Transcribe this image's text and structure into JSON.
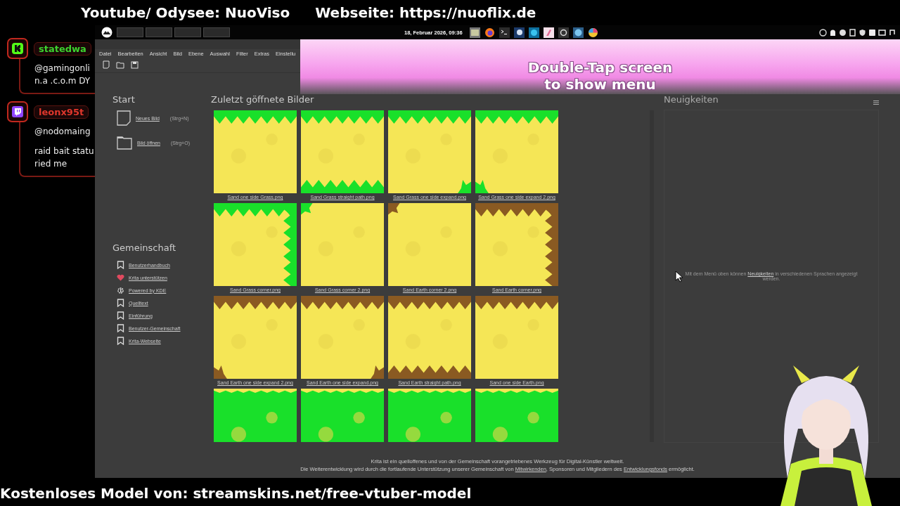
{
  "stream_banner": {
    "left": "Youtube/ Odysee: NuoViso",
    "right": "Webseite: https://nuoflix.de",
    "bottom": "Kostenloses Model von: streamskins.net/free-vtuber-model"
  },
  "chat": [
    {
      "kind": "kick",
      "user": "statedwa",
      "color": "#3cd22e",
      "messages": [
        [
          "@gamingonli",
          "n.a .c.o.m DY"
        ]
      ]
    },
    {
      "kind": "twitch",
      "user": "leonx95t",
      "color": "#e0372c",
      "messages": [
        [
          "@nodomaing"
        ],
        [
          "raid bait statu",
          "ried me"
        ]
      ]
    }
  ],
  "taskbar": {
    "clock": "18, Februar 2026, 09:36"
  },
  "menu": [
    "Datei",
    "Bearbeiten",
    "Ansicht",
    "Bild",
    "Ebene",
    "Auswahl",
    "Filter",
    "Extras",
    "Einstellu"
  ],
  "start": {
    "title": "Start",
    "actions": [
      {
        "kind": "new",
        "label": "Neues Bild",
        "shortcut": "(Strg+N)"
      },
      {
        "kind": "open",
        "label": "Bild öffnen",
        "shortcut": "(Strg+O)"
      }
    ]
  },
  "community": {
    "title": "Gemeinschaft",
    "links": [
      {
        "kind": "bookmark",
        "label": "Benutzerhandbuch"
      },
      {
        "kind": "heart",
        "label": "Krita unterstützen"
      },
      {
        "kind": "kde",
        "label": "Powered by KDE"
      },
      {
        "kind": "bookmark",
        "label": "Quelltext"
      },
      {
        "kind": "bookmark",
        "label": "Einführung"
      },
      {
        "kind": "bookmark",
        "label": "Benutzer-Gemeinschaft"
      },
      {
        "kind": "bookmark",
        "label": "Krita-Webseite"
      }
    ]
  },
  "recent": {
    "title": "Zuletzt göffnete Bilder",
    "items": [
      {
        "kind": "picture",
        "label": "Sand one side Grass.png"
      },
      {
        "kind": "picture",
        "label": "Sand Grass straight path.png"
      },
      {
        "kind": "picture",
        "label": "Sand Grass one side expand.png"
      },
      {
        "kind": "picture",
        "label": "Sand Grass one side expand 2.png"
      },
      {
        "kind": "picture",
        "label": "Sand Grass corner.png"
      },
      {
        "kind": "picture",
        "label": "Sand Grass corner 2.png"
      },
      {
        "kind": "picture",
        "label": "Sand Earth corner 2.png"
      },
      {
        "kind": "picture",
        "label": "Sand Earth corner.png"
      },
      {
        "kind": "picture",
        "label": "Sand Earth one side expand 2.png"
      },
      {
        "kind": "picture",
        "label": "Sand Earth one side expand.png"
      },
      {
        "kind": "picture",
        "label": "Sand Earth straight path.png"
      },
      {
        "kind": "picture",
        "label": "Sand one side Earth.png"
      },
      {
        "kind": "picture"
      },
      {
        "kind": "picture"
      },
      {
        "kind": "picture"
      },
      {
        "kind": "picture"
      }
    ]
  },
  "news": {
    "title": "Neuigkeiten",
    "before": "Mit dem Menü oben können ",
    "link": "Neuigkeiten",
    "after": " in verschiedenen Sprachen angezeigt werden."
  },
  "footer": {
    "line1": "Krita ist ein quelloffenes und von der Gemeinschaft vorangetriebenes Werkzeug für Digital-Künstler weltweit.",
    "line2_a": "Die Weiterentwicklung wird durch die fortlaufende Unterstützung unserer Gemeinschaft von ",
    "link1": "Mitwirkenden",
    "line2_b": ", Sponsoren und Mitgliedern des ",
    "link2": "Entwicklungsfonds",
    "line2_c": " ermöglicht."
  },
  "overlay": {
    "hint": [
      "Double-Tap screen",
      "to show menu"
    ]
  }
}
